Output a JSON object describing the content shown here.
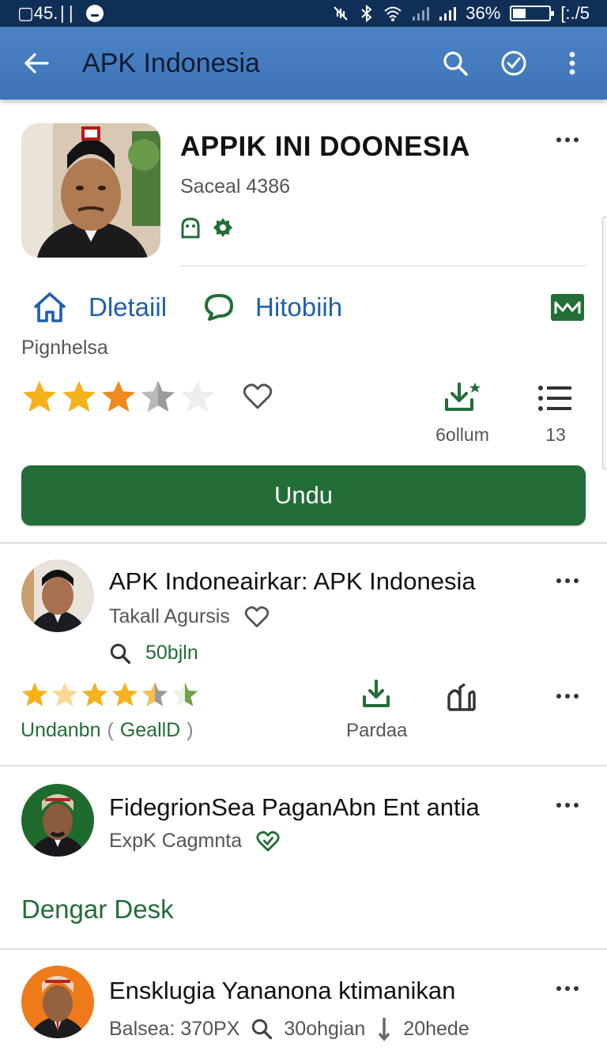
{
  "status_bar": {
    "left_text": "▢45.∣∣",
    "battery_percent": "36%",
    "battery_level": 0.36,
    "time": "[:./5"
  },
  "app_bar": {
    "title": "APK Indonesia"
  },
  "hero": {
    "title": "APPIK INI DOONESIA",
    "subtitle": "Saceal 4386",
    "category": "Pignhelsa",
    "tabs": [
      {
        "label": "Dletaiil",
        "icon": "home-icon"
      },
      {
        "label": "Hitobiih",
        "icon": "chat-icon"
      }
    ],
    "rating_stars": 3.5,
    "downloads": "6ollum",
    "list_count": "13",
    "install_label": "Undu"
  },
  "items": [
    {
      "title": "APK Indoneairkar: APK Indonesia",
      "subtitle": "Takall Agursis",
      "meta": "50bjln",
      "rating_stars": 4,
      "category": "Undanbn",
      "paren_open": "(",
      "paren_text": "GeallD",
      "paren_close": ")",
      "download_label": "Pardaa"
    },
    {
      "title": "FidegrionSea PaganAbn Ent antia",
      "subtitle": "ExpK Cagmnta"
    },
    {
      "title": "Ensklugia Yananona  ktimanikan",
      "subtitle_a": "Balsea: 370PX",
      "subtitle_b": "30ohgian",
      "subtitle_c": "20hede"
    }
  ],
  "section_label": "Dengar Desk",
  "colors": {
    "status_bar": "#0f2f57",
    "app_bar": "#4079bb",
    "primary_green": "#236d38",
    "link_blue": "#1f5fae",
    "star_gold": "#f6b21b",
    "star_orange": "#f08a1c"
  }
}
